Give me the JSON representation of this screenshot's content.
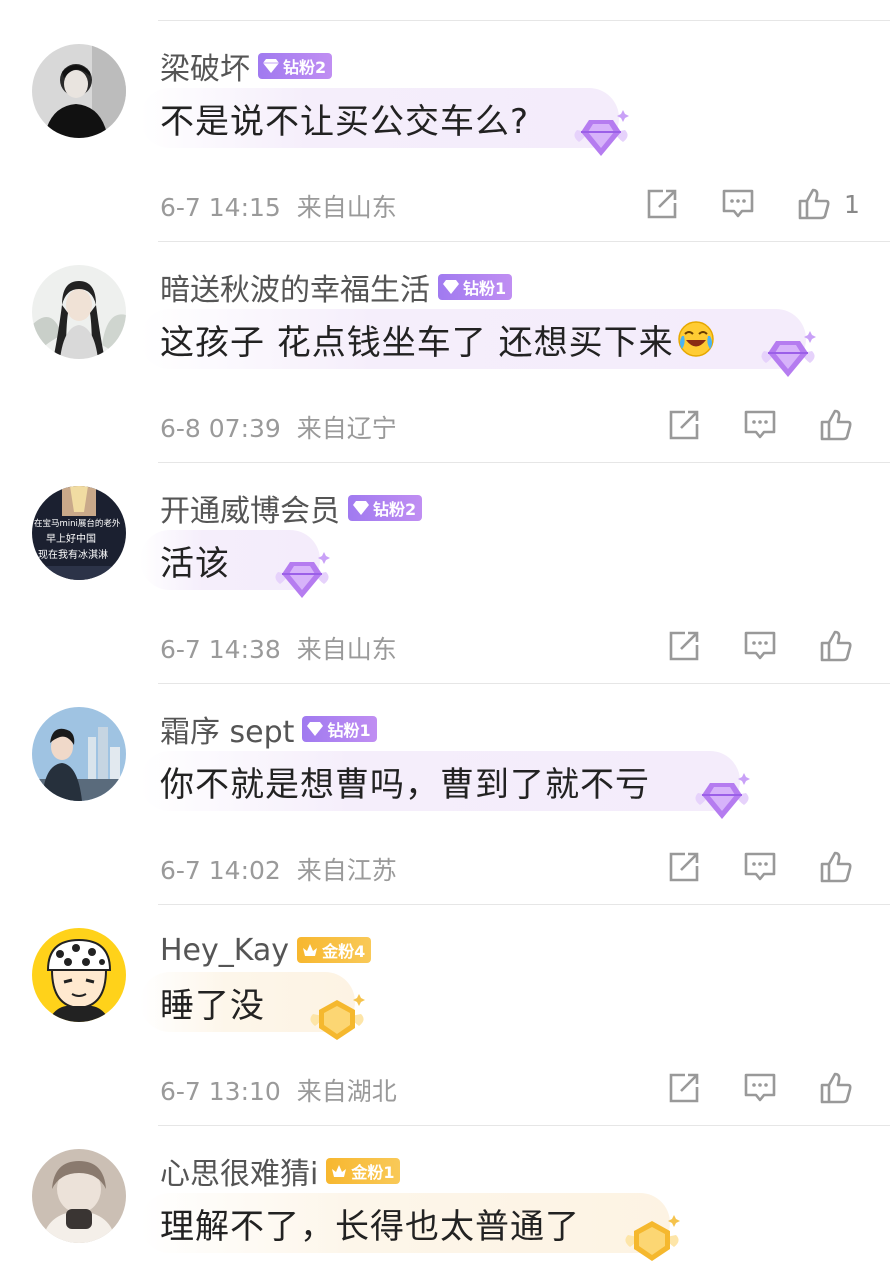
{
  "colors": {
    "diamond_badge": "#a07af0",
    "gold_badge": "#f7b72f",
    "meta_text": "#9a9a9a",
    "bubble_purple": "#f4ecfb",
    "bubble_gold": "#fdf3e3"
  },
  "comments": [
    {
      "username": "梁破坏",
      "badge": "钻粉2",
      "badge_type": "diamond",
      "text": "不是说不让买公交车么?",
      "date": "6-7 14:15",
      "location": "来自山东",
      "likes": "1",
      "emoji": ""
    },
    {
      "username": "暗送秋波的幸福生活",
      "badge": "钻粉1",
      "badge_type": "diamond",
      "text": "这孩子   花点钱坐车了     还想买下来",
      "date": "6-8 07:39",
      "location": "来自辽宁",
      "likes": "",
      "emoji": "laughing-crying-emoji"
    },
    {
      "username": "开通威博会员",
      "badge": "钻粉2",
      "badge_type": "diamond",
      "text": "活该",
      "date": "6-7 14:38",
      "location": "来自山东",
      "likes": "",
      "emoji": ""
    },
    {
      "username": "霜序 sept",
      "badge": "钻粉1",
      "badge_type": "diamond",
      "text": "你不就是想曹吗，曹到了就不亏",
      "date": "6-7 14:02",
      "location": "来自江苏",
      "likes": "",
      "emoji": ""
    },
    {
      "username": "Hey_Kay",
      "badge": "金粉4",
      "badge_type": "gold",
      "text": "睡了没",
      "date": "6-7 13:10",
      "location": "来自湖北",
      "likes": "",
      "emoji": ""
    },
    {
      "username": "心思很难猜i",
      "badge": "金粉1",
      "badge_type": "gold",
      "text": "理解不了，长得也太普通了",
      "date": "",
      "location": "",
      "likes": "",
      "emoji": ""
    }
  ],
  "avatar_overlay_text": {
    "line1": "在宝马mini展台的老外",
    "line2": "早上好中国",
    "line3": "现在我有冰淇淋"
  },
  "icons": [
    "share-icon",
    "comment-icon",
    "like-icon",
    "diamond-gem-icon",
    "gold-crown-icon"
  ]
}
